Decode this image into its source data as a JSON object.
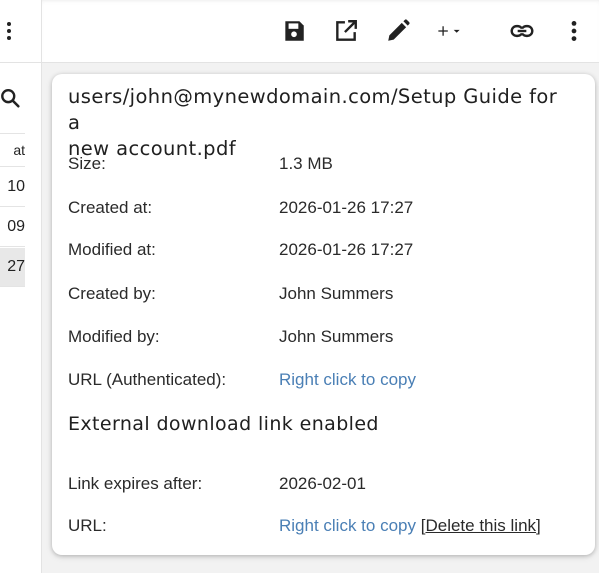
{
  "sidebar": {
    "column_header": "at",
    "rows": [
      "10",
      "09",
      "27"
    ]
  },
  "toolbar": {
    "buttons": [
      {
        "name": "save",
        "icon": "save-icon"
      },
      {
        "name": "open-external",
        "icon": "open-in-new-icon"
      },
      {
        "name": "edit",
        "icon": "pencil-icon"
      },
      {
        "name": "add",
        "icon": "plus-dropdown-icon"
      },
      {
        "name": "link",
        "icon": "link-icon"
      },
      {
        "name": "more",
        "icon": "more-vertical-icon"
      }
    ]
  },
  "file": {
    "path_line1": "users/john@mynewdomain.com/Setup Guide for a",
    "path_line2": "new account.pdf",
    "size_label": "Size:",
    "size_value": "1.3 MB",
    "created_at_label": "Created at:",
    "created_at_value": "2026-01-26 17:27",
    "modified_at_label": "Modified at:",
    "modified_at_value": "2026-01-26 17:27",
    "created_by_label": "Created by:",
    "created_by_value": "John Summers",
    "modified_by_label": "Modified by:",
    "modified_by_value": "John Summers",
    "url_auth_label": "URL (Authenticated):",
    "url_auth_value": "Right click to copy"
  },
  "external": {
    "heading": "External download link enabled",
    "expires_label": "Link expires after:",
    "expires_value": "2026-02-01",
    "url_label": "URL:",
    "url_value": "Right click to copy",
    "bracket_open": "[",
    "delete_label": "Delete this link",
    "bracket_close": "]"
  },
  "colors": {
    "link": "#4a7fb5",
    "background": "#f2f2f2",
    "card": "#ffffff"
  }
}
